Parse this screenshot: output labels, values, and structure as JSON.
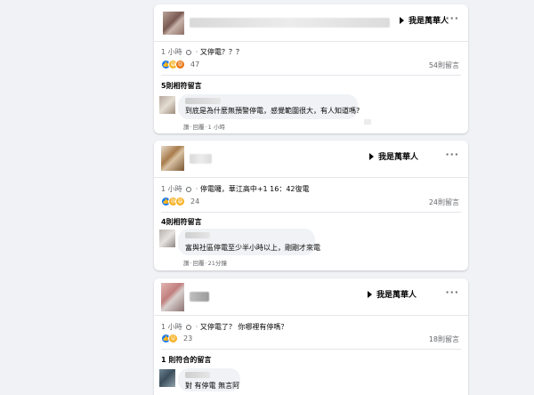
{
  "chart_data": {
    "type": "table",
    "posts": [
      {
        "group": "我是萬華人",
        "time": "1 小時",
        "text": "又停電？？？",
        "reactions": 47,
        "comments": "54則留言",
        "section": "5則相符留言",
        "comment_text": "到底是為什麼無預警停電，感覺範圍很大，有人知道嗎?",
        "comment_actions": [
          "讚",
          "回覆",
          "1 小時"
        ]
      },
      {
        "group": "我是萬華人",
        "time": "1 小時",
        "text": "停電囉，華江高中+1 16：42復電",
        "reactions": 24,
        "comments": "24則留言",
        "section": "4則相符留言",
        "comment_text": "富與社區停電至少半小時以上，剛剛才來電",
        "comment_actions": [
          "讚",
          "回覆",
          "21分鐘"
        ]
      },
      {
        "group": "我是萬華人",
        "time": "1 小時",
        "text": "又停電了？ 你哪裡有停嗎？",
        "reactions": 23,
        "comments": "18則留言",
        "section": "1 則符合的留言",
        "comment_text": "對 有停電 無言阿",
        "comment_actions": []
      }
    ]
  },
  "ui": {
    "more": "···",
    "sep": "·"
  }
}
